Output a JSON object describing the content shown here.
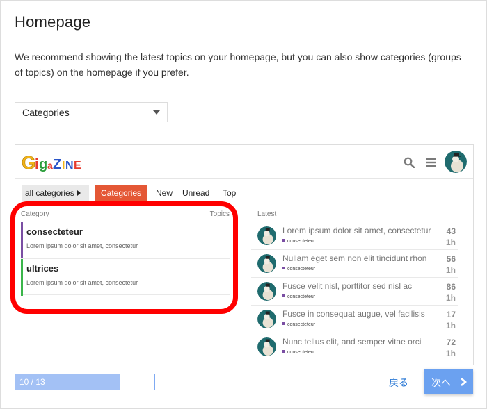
{
  "page": {
    "title": "Homepage",
    "description": "We recommend showing the latest topics on your homepage, but you can also show categories (groups of topics) on the homepage if you prefer."
  },
  "homepage_select": {
    "value": "Categories"
  },
  "preview": {
    "logo_text": "GigaZINE",
    "header_icons": [
      "search-icon",
      "hamburger-menu-icon",
      "user-avatar"
    ],
    "nav": {
      "all_categories": "all categories",
      "tabs": [
        "Categories",
        "New",
        "Unread",
        "Top"
      ],
      "active_tab": "Categories",
      "active_color": "#e45735"
    },
    "categories_header": {
      "category": "Category",
      "topics": "Topics"
    },
    "categories": [
      {
        "name": "consecteteur",
        "description": "Lorem ipsum dolor sit amet, consectetur",
        "color": "#7a4ea3"
      },
      {
        "name": "ultrices",
        "description": "Lorem ipsum dolor sit amet, consectetur",
        "color": "#3ab54a"
      }
    ],
    "latest_header": "Latest",
    "latest": [
      {
        "title": "Lorem ipsum dolor sit amet, consectetur",
        "category": "consecteteur",
        "count": "43",
        "age": "1h"
      },
      {
        "title": "Nullam eget sem non elit tincidunt rhon",
        "category": "consecteteur",
        "count": "56",
        "age": "1h"
      },
      {
        "title": "Fusce velit nisl, porttitor sed nisl ac",
        "category": "consecteteur",
        "count": "86",
        "age": "1h"
      },
      {
        "title": "Fusce in consequat augue, vel facilisis",
        "category": "consecteteur",
        "count": "17",
        "age": "1h"
      },
      {
        "title": "Nunc tellus elit, and semper vitae orci",
        "category": "consecteteur",
        "count": "72",
        "age": "1h"
      }
    ]
  },
  "progress": {
    "label": "10 / 13",
    "current": 10,
    "total": 13,
    "fraction": 0.75
  },
  "buttons": {
    "back": "戻る",
    "next": "次へ"
  },
  "colors": {
    "accent": "#6ba1f0",
    "highlight": "#ff0000",
    "link": "#2e7bd6"
  }
}
